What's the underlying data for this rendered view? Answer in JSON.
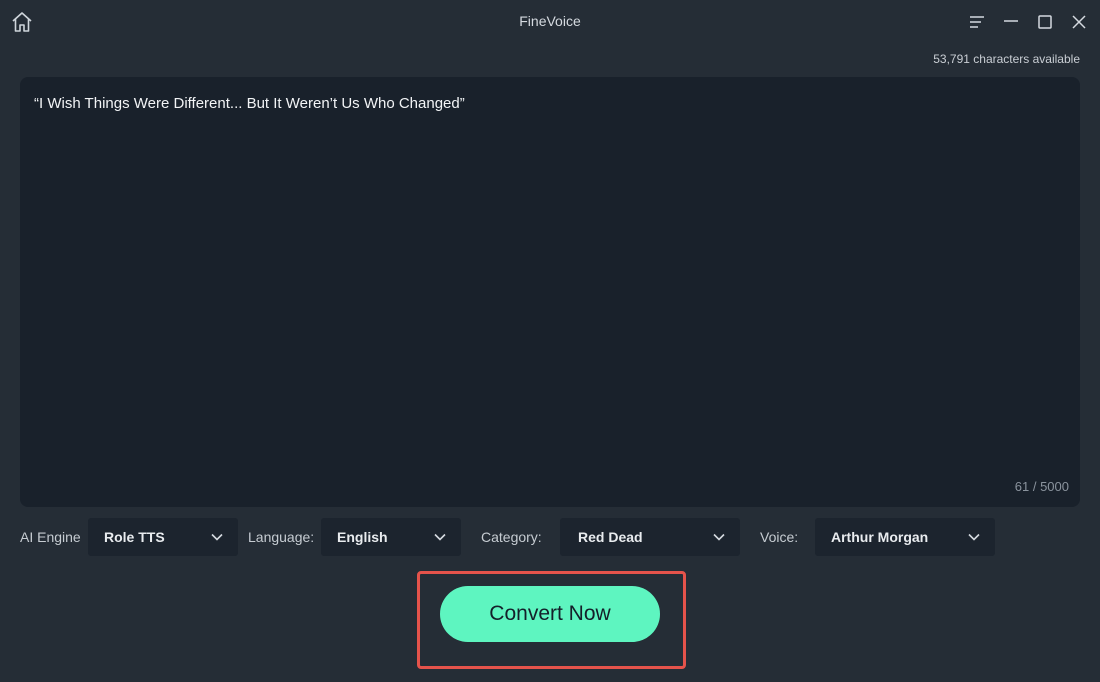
{
  "app": {
    "title": "FineVoice",
    "icons": {
      "home": "home-icon",
      "menu": "menu-icon",
      "minimize": "minimize-icon",
      "maximize": "maximize-icon",
      "close": "close-icon"
    }
  },
  "editor": {
    "chars_available": "53,791 characters available",
    "text": "“I Wish Things Were Different... But It Weren’t Us Who Changed”",
    "count": "61 / 5000"
  },
  "controls": {
    "engine": {
      "label": "AI Engine",
      "value": "Role TTS"
    },
    "language": {
      "label": "Language:",
      "value": "English"
    },
    "category": {
      "label": "Category:",
      "value": "Red Dead"
    },
    "voice": {
      "label": "Voice:",
      "value": "Arthur Morgan"
    }
  },
  "action": {
    "convert_label": "Convert Now"
  },
  "colors": {
    "accent": "#5ef5c0",
    "highlight": "#e5534b",
    "background": "#252d36",
    "editor_bg": "#19212b"
  }
}
